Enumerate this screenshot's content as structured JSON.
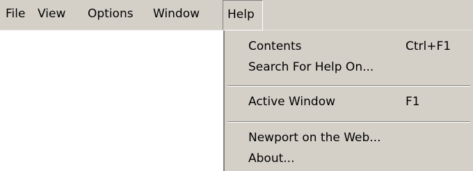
{
  "menubar": {
    "items": [
      {
        "label": "File"
      },
      {
        "label": "View"
      },
      {
        "label": "Options"
      },
      {
        "label": "Window"
      },
      {
        "label": "Help"
      }
    ]
  },
  "help_menu": {
    "items": [
      {
        "label": "Contents",
        "shortcut": "Ctrl+F1"
      },
      {
        "label": "Search For Help On...",
        "shortcut": ""
      },
      {
        "label": "Active Window",
        "shortcut": "F1"
      },
      {
        "label": "Newport on the Web...",
        "shortcut": ""
      },
      {
        "label": "About...",
        "shortcut": ""
      }
    ]
  },
  "colors": {
    "menu_background": "#d4d0c8",
    "content_background": "#ffffff",
    "text": "#000000",
    "separator_shadow": "#808080"
  }
}
